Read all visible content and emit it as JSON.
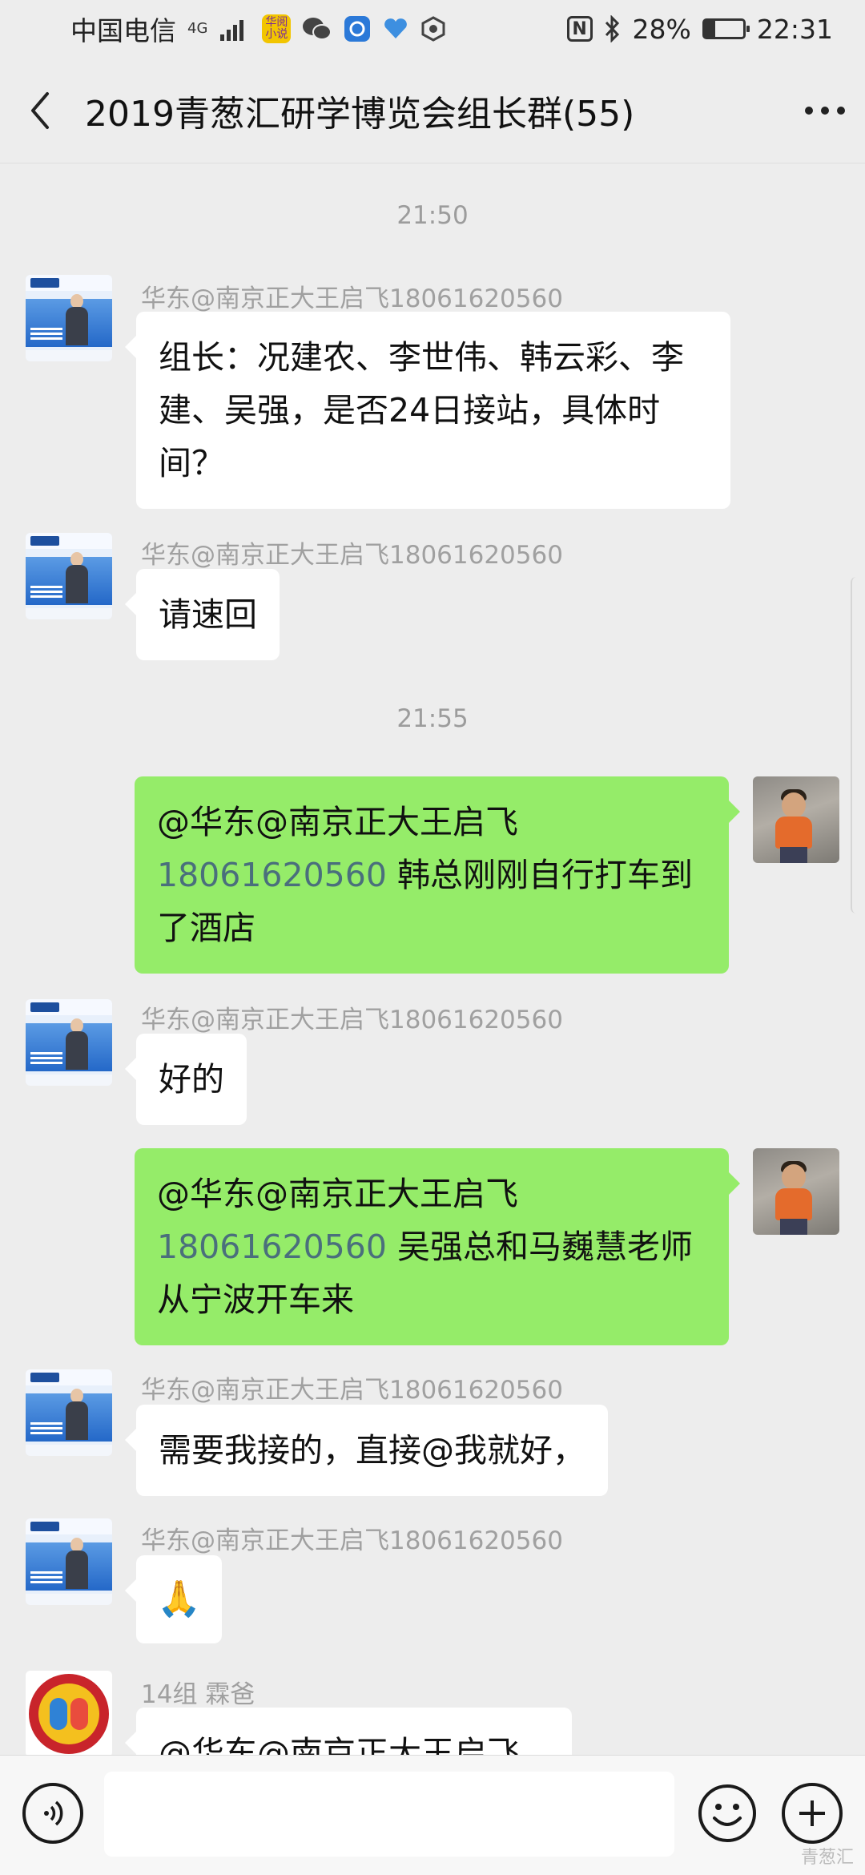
{
  "status_bar": {
    "carrier": "中国电信",
    "network": "4G",
    "app_badge": "华阅小说",
    "nfc": "N",
    "battery_percent": "28%",
    "battery_level": 0.28,
    "time": "22:31"
  },
  "header": {
    "title": "2019青葱汇研学博览会组长群(55)",
    "more_label": "···"
  },
  "messages": {
    "t1": "21:50",
    "m1_sender": "华东@南京正大王启飞18061620560",
    "m1_text": "组长：况建农、李世伟、韩云彩、李建、吴强，是否24日接站，具体时间？",
    "m2_sender": "华东@南京正大王启飞18061620560",
    "m2_text": "请速回",
    "t2": "21:55",
    "m3_prefix": "@华东@南京正大王启飞",
    "m3_phone": "18061620560",
    "m3_text": " 韩总刚刚自行打车到了酒店",
    "m4_sender": "华东@南京正大王启飞18061620560",
    "m4_text": "好的",
    "m5_prefix": "@华东@南京正大王启飞",
    "m5_phone": "18061620560",
    "m5_text": " 吴强总和马巍慧老师从宁波开车来",
    "m6_sender": "华东@南京正大王启飞18061620560",
    "m6_text": "需要我接的，直接@我就好，",
    "m7_sender": "华东@南京正大王启飞18061620560",
    "m7_text": "🙏",
    "m8_sender": "14组  霖爸",
    "m8_text": "@华东@南京正大王启飞"
  },
  "watermark": "青葱汇",
  "colors": {
    "background": "#ededed",
    "bubble_self": "#95ec69",
    "bubble_other": "#ffffff",
    "mention_phone": "#4a6f7c",
    "timestamp": "#9c9c9c"
  }
}
